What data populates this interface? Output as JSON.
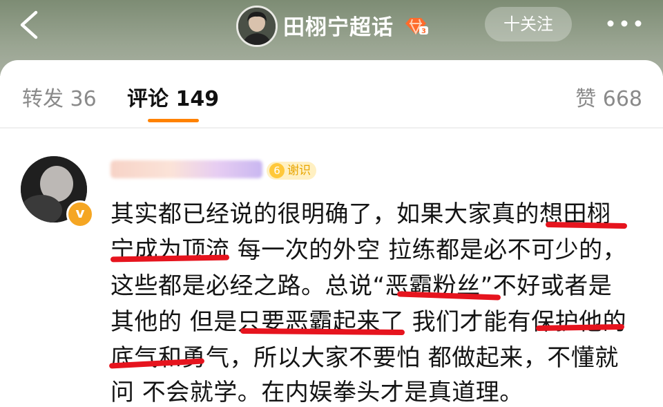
{
  "header": {
    "topic_title": "田栩宁超话",
    "follow_label": "十关注"
  },
  "tabs": {
    "repost": "转发 36",
    "comment": "评论 149",
    "like": "赞 668"
  },
  "comment": {
    "level": "6",
    "level_label": "谢识",
    "lines": [
      "其实都已经说的很明确了，如果大家真的想田栩",
      "宁成为顶流 每一次的外空 拉练都是必不可少的，",
      "这些都是必经之路。总说“恶霸粉丝”不好或者是",
      "其他的 但是只要恶霸起来了 我们才能有保护他的",
      "底气和勇气，所以大家不要怕 都做起来，不懂就",
      "问 不会就学。在内娱拳头才是真道理。"
    ]
  },
  "colors": {
    "accent_orange": "#ff8200",
    "underline_red": "#e6141e"
  },
  "icons": [
    "back-arrow-icon",
    "topic-badge-icon",
    "more-icon",
    "verified-badge-icon"
  ]
}
